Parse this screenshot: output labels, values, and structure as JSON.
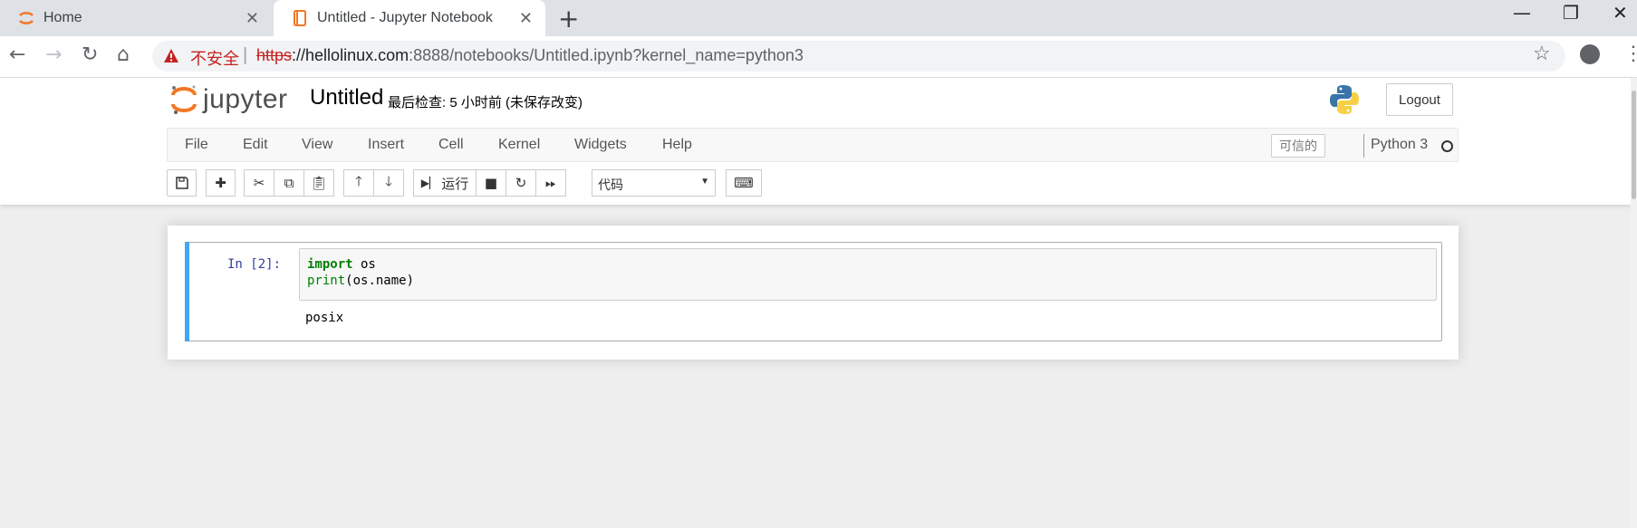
{
  "browser": {
    "tabs": [
      {
        "title": "Home",
        "active": false
      },
      {
        "title": "Untitled - Jupyter Notebook",
        "active": true
      }
    ],
    "new_tab": "+",
    "window_controls": {
      "minimize": "—",
      "maximize": "❐",
      "close": "✕"
    },
    "address": {
      "security_label": "不安全",
      "separator": "|",
      "scheme": "https",
      "host": "://hellolinux.com",
      "rest": ":8888/notebooks/Untitled.ipynb?kernel_name=python3"
    }
  },
  "notebook": {
    "logo_text": "jupyter",
    "name": "Untitled",
    "checkpoint": "最后检查: 5 小时前   (未保存改变)",
    "logout_label": "Logout",
    "menu": [
      "File",
      "Edit",
      "View",
      "Insert",
      "Cell",
      "Kernel",
      "Widgets",
      "Help"
    ],
    "trusted_label": "可信的",
    "kernel_name": "Python 3",
    "toolbar": {
      "run_label": "运行",
      "cell_type": "代码"
    },
    "cells": [
      {
        "prompt": "In  [2]:",
        "code_line1_kw": "import",
        "code_line1_rest": " os",
        "code_line2_fn": "print",
        "code_line2_rest": "(os.name)",
        "output": "posix"
      }
    ]
  },
  "colors": {
    "accent": "#f37726",
    "cell_selected_bar": "#42a5f5",
    "insecure_red": "#c5221f"
  }
}
